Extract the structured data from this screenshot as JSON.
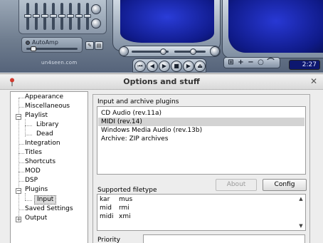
{
  "player": {
    "autoamp_label": "AutoAmp",
    "site_text": "un4seen.com",
    "time": "2:27",
    "buttons": {
      "prev": "⏮",
      "rewind": "◀",
      "play": "▶",
      "stop": "■",
      "forward": "▶",
      "eject": "⏏"
    }
  },
  "dialog": {
    "title": "Options and stuff",
    "close_label": "✕",
    "tree": {
      "items": [
        {
          "label": "Appearance"
        },
        {
          "label": "Miscellaneous"
        },
        {
          "label": "Playlist"
        },
        {
          "label": "Library"
        },
        {
          "label": "Dead"
        },
        {
          "label": "Integration"
        },
        {
          "label": "Titles"
        },
        {
          "label": "Shortcuts"
        },
        {
          "label": "MOD"
        },
        {
          "label": "DSP"
        },
        {
          "label": "Plugins"
        },
        {
          "label": "Input"
        },
        {
          "label": "Saved Settings"
        },
        {
          "label": "Output"
        }
      ]
    },
    "plugins": {
      "group_title": "Input and archive plugins",
      "list": [
        "CD Audio (rev.11a)",
        "MIDI (rev.14)",
        "Windows Media Audio (rev.13b)",
        "Archive: ZIP archives"
      ],
      "selected_index": 1,
      "about_label": "About",
      "config_label": "Config",
      "filetype_label": "Supported filetype",
      "filetypes": [
        [
          "kar",
          "mus"
        ],
        [
          "mid",
          "rmi"
        ],
        [
          "midi",
          "xmi"
        ]
      ],
      "priority_label": "Priority"
    }
  }
}
